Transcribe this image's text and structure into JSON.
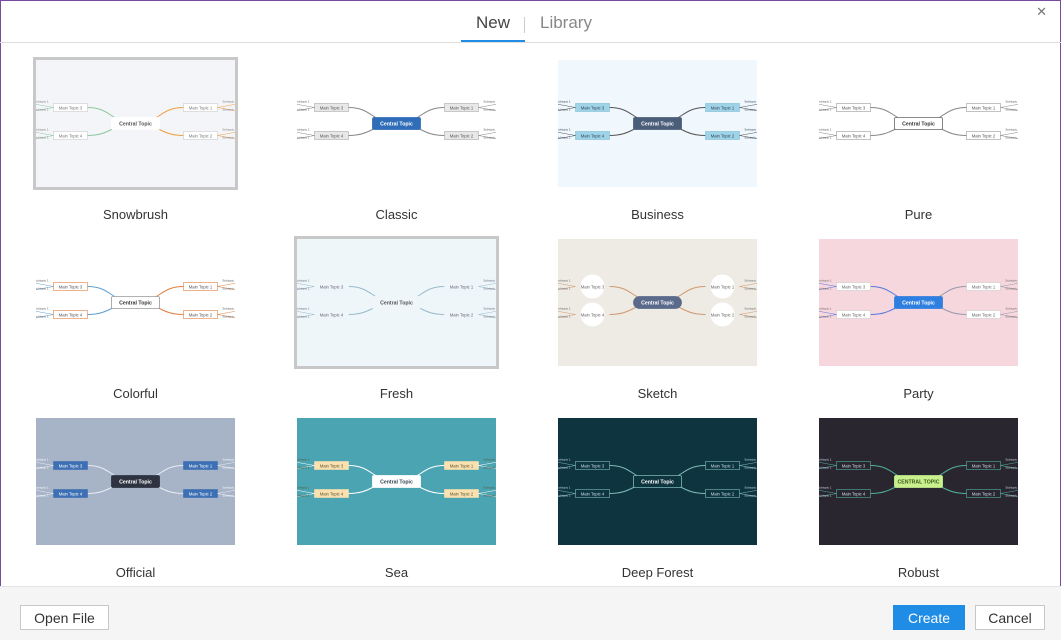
{
  "tabs": [
    {
      "label": "New",
      "active": true
    },
    {
      "label": "Library",
      "active": false
    }
  ],
  "templates": [
    {
      "name": "Snowbrush",
      "bg": "#f4f5f9",
      "selected": true
    },
    {
      "name": "Classic",
      "bg": "#ffffff"
    },
    {
      "name": "Business",
      "bg": "#f0f7fd"
    },
    {
      "name": "Pure",
      "bg": "#ffffff"
    },
    {
      "name": "Colorful",
      "bg": "#ffffff"
    },
    {
      "name": "Fresh",
      "bg": "#eef6f9",
      "selected": true
    },
    {
      "name": "Sketch",
      "bg": "#eeeae4"
    },
    {
      "name": "Party",
      "bg": "#f7d7de"
    },
    {
      "name": "Official",
      "bg": "#a7b3c7"
    },
    {
      "name": "Sea",
      "bg": "#4ba4b2"
    },
    {
      "name": "Deep Forest",
      "bg": "#0e3440"
    },
    {
      "name": "Robust",
      "bg": "#2a2630"
    }
  ],
  "map_text": {
    "central": "Central Topic",
    "central_upper": "CENTRAL TOPIC",
    "main1": "Main Topic 1",
    "main2": "Main Topic 2",
    "main3": "Main Topic 3",
    "main4": "Main Topic 4",
    "subtopic": "Subtopic 1"
  },
  "footer": {
    "open_file": "Open File",
    "create": "Create",
    "cancel": "Cancel"
  },
  "colors": {
    "accent": "#1f8ce6",
    "window_border": "#7a4a9e"
  }
}
